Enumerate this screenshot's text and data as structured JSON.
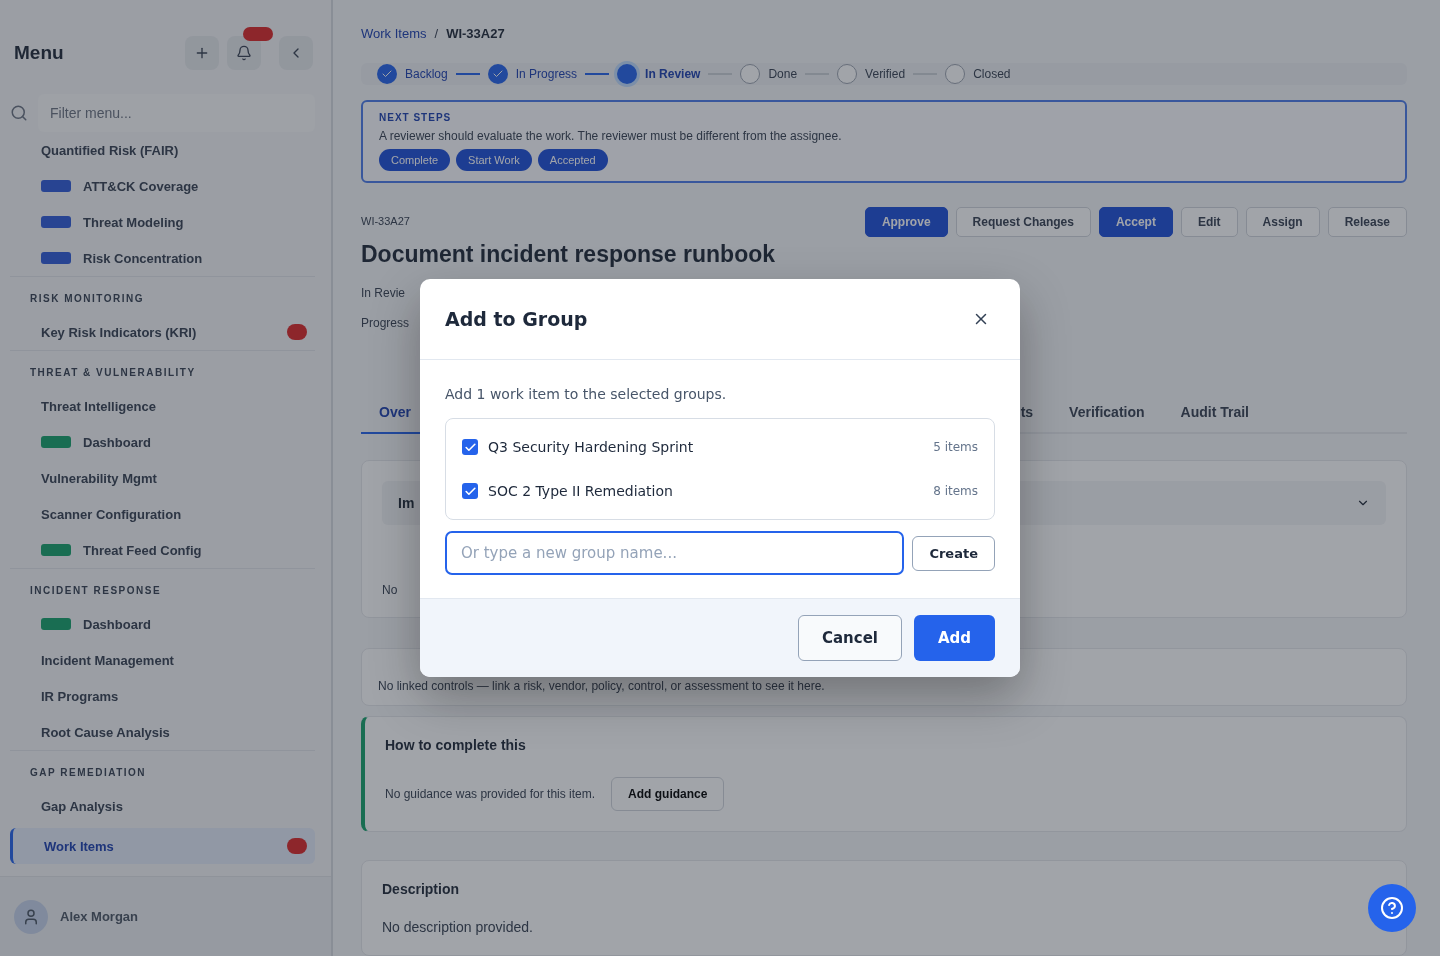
{
  "sidebar": {
    "title": "Menu",
    "filter_placeholder": "Filter menu...",
    "sections": [
      {
        "items": [
          {
            "label": "Quantified Risk (FAIR)",
            "kind": "plain",
            "selected": false
          },
          {
            "label": "ATT&CK Coverage",
            "kind": "info",
            "selected": false
          },
          {
            "label": "Threat Modeling",
            "kind": "info",
            "selected": false
          },
          {
            "label": "Risk Concentration",
            "kind": "info",
            "selected": false
          }
        ]
      },
      {
        "heading": "RISK MONITORING",
        "items": [
          {
            "label": "Key Risk Indicators (KRI)",
            "kind": "plain",
            "alert": true,
            "selected": false
          }
        ]
      },
      {
        "heading": "THREAT & VULNERABILITY",
        "items": [
          {
            "label": "Threat Intelligence",
            "kind": "plain",
            "selected": false
          },
          {
            "label": "Dashboard",
            "kind": "success",
            "selected": false
          },
          {
            "label": "Vulnerability Mgmt",
            "kind": "plain",
            "selected": false
          },
          {
            "label": "Scanner Configuration",
            "kind": "plain",
            "selected": false
          },
          {
            "label": "Threat Feed Config",
            "kind": "success",
            "selected": false
          }
        ]
      },
      {
        "heading": "INCIDENT RESPONSE",
        "items": [
          {
            "label": "Dashboard",
            "kind": "success",
            "selected": false
          },
          {
            "label": "Incident Management",
            "kind": "plain",
            "selected": false
          },
          {
            "label": "IR Programs",
            "kind": "plain",
            "selected": false
          },
          {
            "label": "Root Cause Analysis",
            "kind": "plain",
            "selected": false
          }
        ]
      },
      {
        "heading": "GAP REMEDIATION",
        "items": [
          {
            "label": "Gap Analysis",
            "kind": "plain",
            "selected": false
          },
          {
            "label": "Work Items",
            "kind": "plain",
            "alert": true,
            "selected": true
          }
        ]
      }
    ],
    "user": {
      "name": "Alex Morgan"
    }
  },
  "breadcrumb": [
    "Work Items",
    "WI-33A27"
  ],
  "breadcrumb_separator": "/",
  "steps": [
    {
      "label": "Backlog",
      "completed": true,
      "selected": false
    },
    {
      "label": "In Progress",
      "completed": true,
      "selected": false
    },
    {
      "label": "In Review",
      "completed": false,
      "selected": true
    },
    {
      "label": "Done",
      "completed": false,
      "selected": false
    },
    {
      "label": "Verified",
      "completed": false,
      "selected": false
    },
    {
      "label": "Closed",
      "completed": false,
      "selected": false
    }
  ],
  "next_steps": {
    "heading": "NEXT STEPS",
    "text": "A reviewer should evaluate the work. The reviewer must be different from the assignee.",
    "chips": [
      "Complete",
      "Start Work",
      "Accepted"
    ]
  },
  "item": {
    "id": "WI-33A27",
    "title": "Document incident response runbook",
    "status": "In Revie",
    "progress_label": "Progress"
  },
  "actions": [
    {
      "label": "Approve",
      "primary": true
    },
    {
      "label": "Request Changes",
      "primary": false
    },
    {
      "label": "Accept",
      "primary": true
    },
    {
      "label": "Edit",
      "primary": false
    },
    {
      "label": "Assign",
      "primary": false
    },
    {
      "label": "Release",
      "primary": false
    }
  ],
  "tabs": [
    {
      "label": "Over",
      "selected": true
    },
    {
      "label": "ts",
      "selected": false
    },
    {
      "label": "Verification",
      "selected": false
    },
    {
      "label": "Audit Trail",
      "selected": false
    }
  ],
  "overview_card": {
    "accordion_label": "Im",
    "note": "No"
  },
  "links_note": "No linked controls — link a risk, vendor, policy, control, or assessment to see it here.",
  "guidance": {
    "heading": "How to complete this",
    "text": "No guidance was provided for this item.",
    "button": "Add guidance"
  },
  "description": {
    "heading": "Description",
    "text": "No description provided."
  },
  "dialog": {
    "title": "Add to Group",
    "intro": "Add 1 work item to the selected groups.",
    "groups": [
      {
        "name": "Q3 Security Hardening Sprint",
        "count": "5 items",
        "checked": true
      },
      {
        "name": "SOC 2 Type II Remediation",
        "count": "8 items",
        "checked": true
      }
    ],
    "new_group_placeholder": "Or type a new group name...",
    "create_button": "Create",
    "cancel_button": "Cancel",
    "add_button": "Add"
  }
}
